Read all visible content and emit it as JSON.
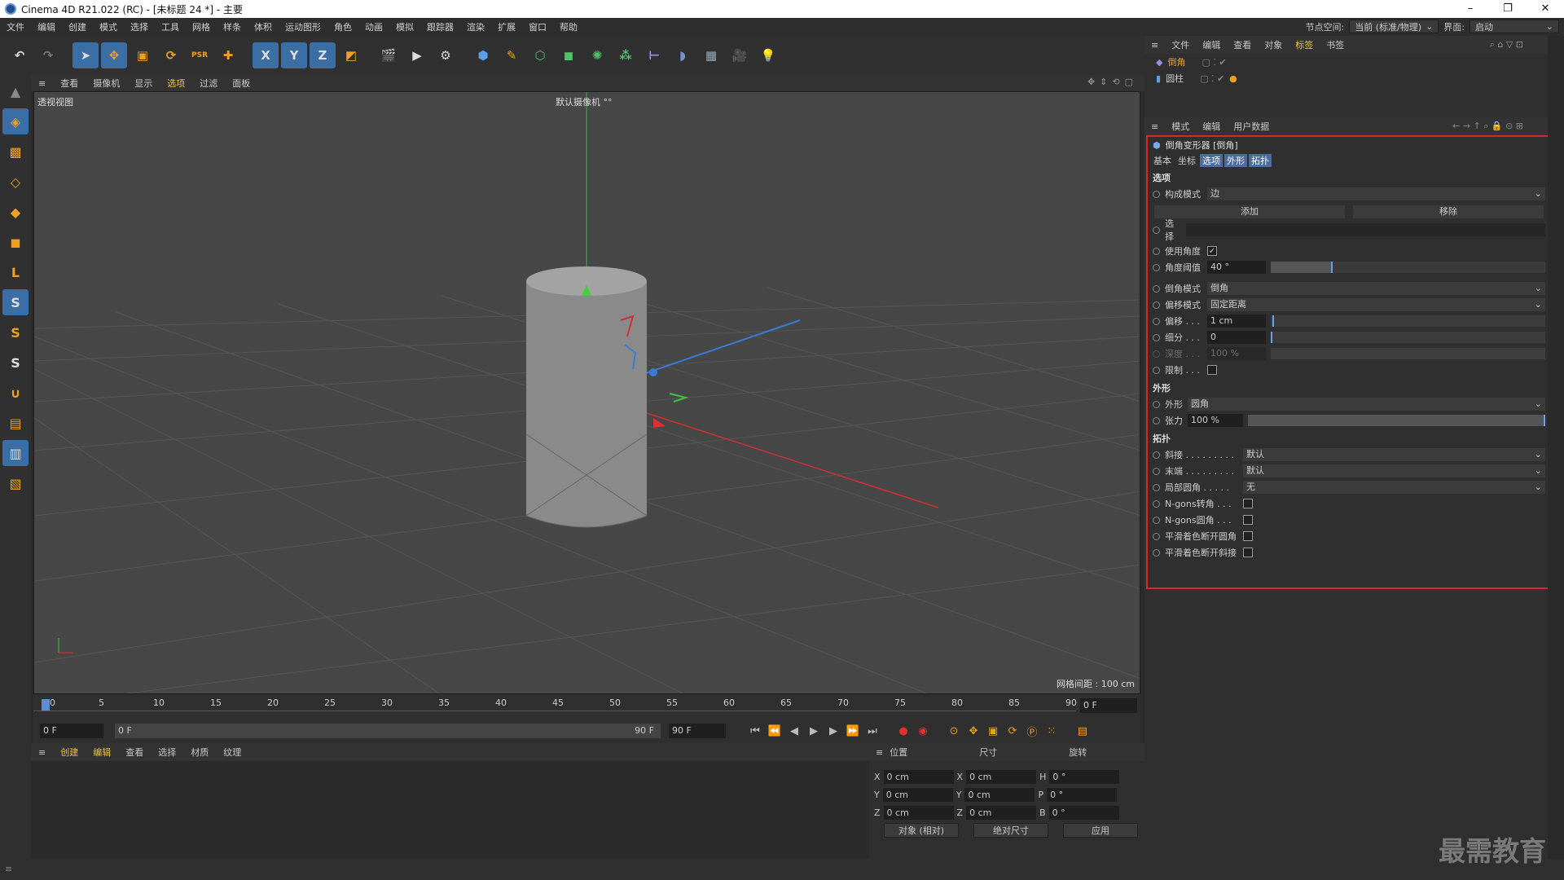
{
  "window": {
    "title": "Cinema 4D R21.022 (RC) - [未标题 24 *] - 主要",
    "controls": [
      "–",
      "❐",
      "✕"
    ]
  },
  "menubar": {
    "items": [
      "文件",
      "编辑",
      "创建",
      "模式",
      "选择",
      "工具",
      "网格",
      "样条",
      "体积",
      "运动图形",
      "角色",
      "动画",
      "模拟",
      "跟踪器",
      "渲染",
      "扩展",
      "窗口",
      "帮助"
    ],
    "node_space_label": "节点空间:",
    "node_space_value": "当前 (标准/物理)",
    "layout_label": "界面:",
    "layout_value": "启动"
  },
  "toolbar": {
    "axis_x": "X",
    "axis_y": "Y",
    "axis_z": "Z"
  },
  "viewport": {
    "menu": [
      "查看",
      "摄像机",
      "显示",
      "选项",
      "过滤",
      "面板"
    ],
    "label": "透视视图",
    "camera": "默认摄像机 °°",
    "grid_spacing": "网格间距 : 100 cm"
  },
  "timeline": {
    "ticks": [
      "0",
      "5",
      "10",
      "15",
      "20",
      "25",
      "30",
      "35",
      "40",
      "45",
      "50",
      "55",
      "60",
      "65",
      "70",
      "75",
      "80",
      "85",
      "90"
    ],
    "current_frame": "0 F",
    "start": "0 F",
    "range_start": "0 F",
    "range_end": "90 F",
    "end": "90 F"
  },
  "material_manager": {
    "menu": [
      "创建",
      "编辑",
      "查看",
      "选择",
      "材质",
      "纹理"
    ]
  },
  "coordinates": {
    "headers": [
      "位置",
      "尺寸",
      "旋转"
    ],
    "rows": [
      {
        "axis": "X",
        "pos": "0 cm",
        "size": "0 cm",
        "rot_axis": "H",
        "rot": "0 °"
      },
      {
        "axis": "Y",
        "pos": "0 cm",
        "size": "0 cm",
        "rot_axis": "P",
        "rot": "0 °"
      },
      {
        "axis": "Z",
        "pos": "0 cm",
        "size": "0 cm",
        "rot_axis": "B",
        "rot": "0 °"
      }
    ],
    "mode": "对象 (相对)",
    "size_mode": "绝对尺寸",
    "apply": "应用"
  },
  "object_manager": {
    "menu": [
      "文件",
      "编辑",
      "查看",
      "对象",
      "标签",
      "书签"
    ],
    "objects": [
      {
        "name": "倒角"
      },
      {
        "name": "圆柱"
      }
    ]
  },
  "attributes": {
    "menu": [
      "模式",
      "编辑",
      "用户数据"
    ],
    "title": "倒角变形器 [倒角]",
    "tabs": [
      "基本",
      "坐标",
      "选项",
      "外形",
      "拓扑"
    ],
    "section_options": "选项",
    "build_mode_label": "构成模式",
    "build_mode": "边",
    "add": "添加",
    "remove": "移除",
    "selection_label": "选择",
    "use_angle_label": "使用角度",
    "angle_threshold_label": "角度阈值",
    "angle_threshold": "40 °",
    "angle_fraction": 0.22,
    "bevel_mode_label": "倒角模式",
    "bevel_mode": "倒角",
    "offset_mode_label": "偏移模式",
    "offset_mode": "固定距离",
    "offset_label": "偏移 . . .",
    "offset": "1 cm",
    "subdiv_label": "细分 . . .",
    "subdiv": "0",
    "depth_label": "深度 . . .",
    "depth": "100 %",
    "limit_label": "限制 . . .",
    "section_shape": "外形",
    "shape_label": "外形",
    "shape": "圆角",
    "tension_label": "张力",
    "tension": "100 %",
    "section_topology": "拓扑",
    "miter_label": "斜接 . . . . . . . . .",
    "miter": "默认",
    "end_label": "末端 . . . . . . . . .",
    "end": "默认",
    "partial_label": "局部圆角 . . . . .",
    "partial": "无",
    "ngon_corner": "N-gons转角 . . .",
    "ngon_round": "N-gons圆角 . . .",
    "phong_round": "平滑着色断开圆角",
    "phong_miter": "平滑着色断开斜接"
  },
  "watermark": "最需教育",
  "colors": {
    "accent": "#3a6ea5",
    "highlight": "#e0252a",
    "tab_active": "#4b6c9c"
  }
}
